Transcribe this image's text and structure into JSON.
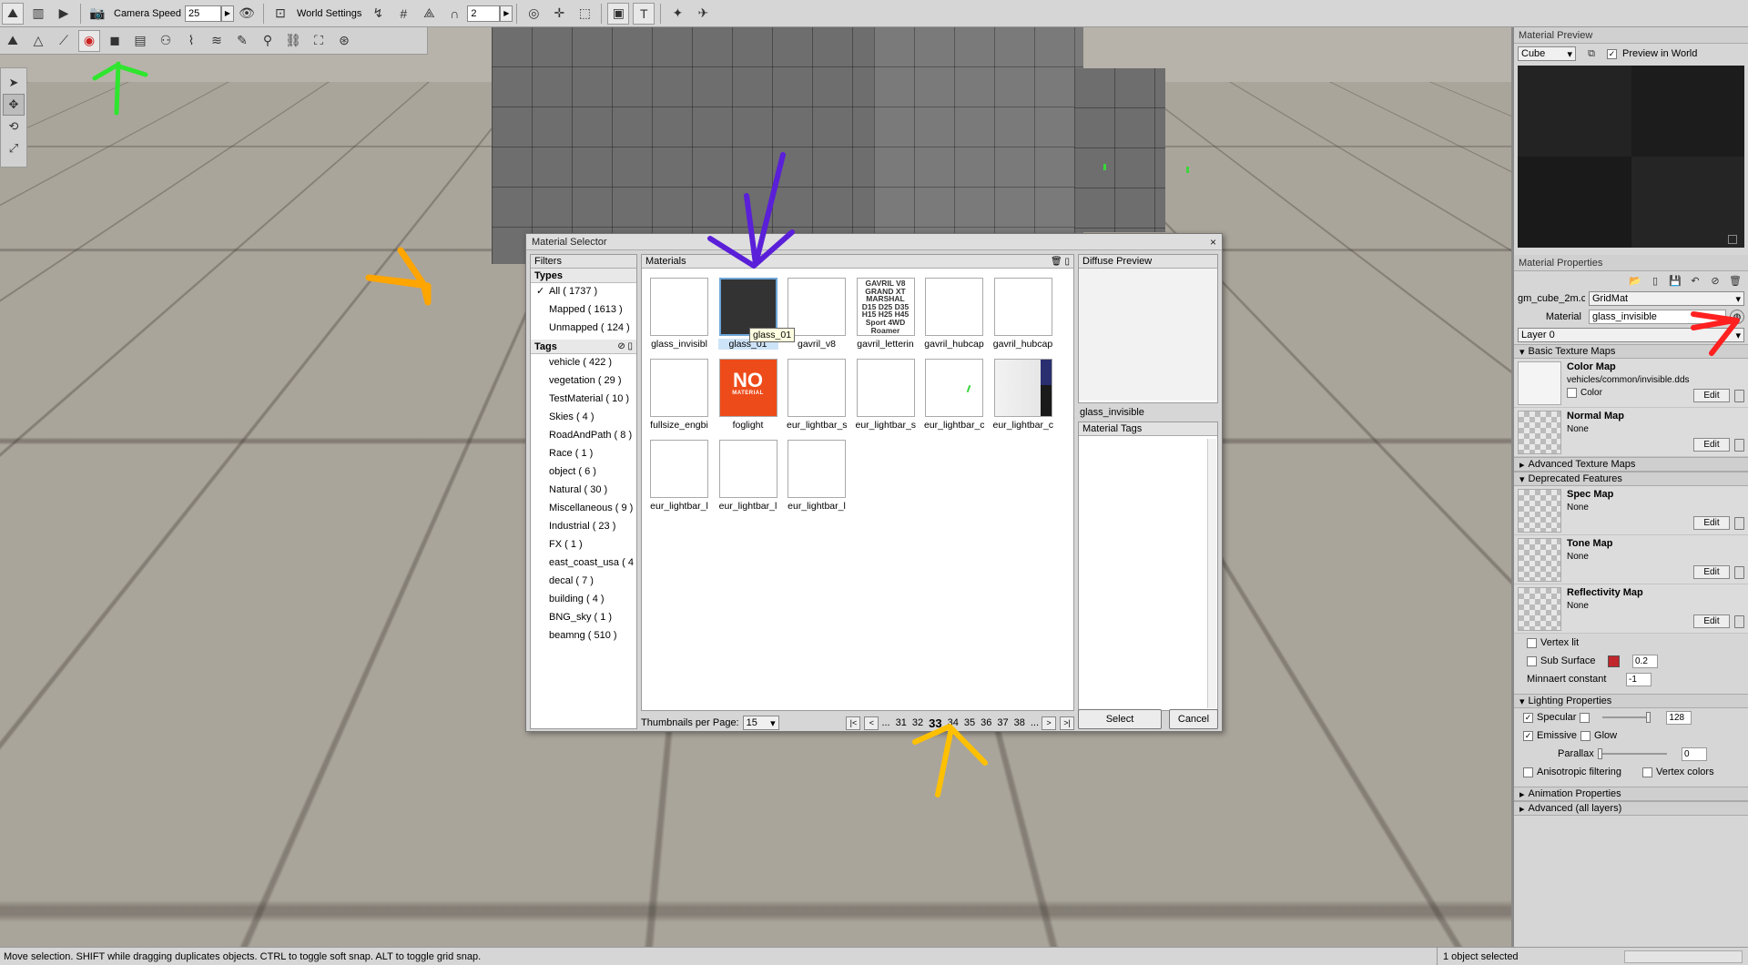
{
  "toolbar": {
    "camera_speed_label": "Camera Speed",
    "camera_speed_value": "25",
    "world_settings_label": "World Settings",
    "snap_value": "2"
  },
  "statusbar": {
    "message": "Move selection.  SHIFT while dragging duplicates objects.  CTRL to toggle soft snap.  ALT to toggle grid snap.",
    "selected": "1 object selected"
  },
  "material_preview": {
    "title": "Material Preview",
    "shape": "Cube",
    "preview_in_world": "Preview in World"
  },
  "material_properties": {
    "title": "Material Properties",
    "object_name": "gm_cube_2m.c",
    "object_material": "GridMat",
    "material_label": "Material",
    "material_value": "glass_invisible",
    "layer": "Layer 0",
    "basic_texture_maps": "Basic Texture Maps",
    "color_map": {
      "name": "Color Map",
      "path": "vehicles/common/invisible.dds",
      "color_label": "Color",
      "edit": "Edit"
    },
    "normal_map": {
      "name": "Normal Map",
      "value": "None",
      "edit": "Edit"
    },
    "advanced_texture_maps": "Advanced Texture Maps",
    "deprecated_features": "Deprecated Features",
    "spec_map": {
      "name": "Spec Map",
      "value": "None",
      "edit": "Edit"
    },
    "tone_map": {
      "name": "Tone Map",
      "value": "None",
      "edit": "Edit"
    },
    "reflectivity_map": {
      "name": "Reflectivity Map",
      "value": "None",
      "edit": "Edit"
    },
    "vertex_lit": "Vertex lit",
    "sub_surface": "Sub Surface",
    "sub_surface_value": "0.2",
    "sub_surface_color": "#c0262b",
    "minnaert_label": "Minnaert constant",
    "minnaert_value": "-1",
    "lighting_properties": "Lighting Properties",
    "specular": "Specular",
    "specular_value": "128",
    "emissive": "Emissive",
    "glow": "Glow",
    "parallax": "Parallax",
    "parallax_value": "0",
    "anisotropic": "Anisotropic filtering",
    "vertex_colors": "Vertex colors",
    "animation_properties": "Animation Properties",
    "advanced_all_layers": "Advanced (all layers)"
  },
  "dialog": {
    "title": "Material Selector",
    "filters_label": "Filters",
    "types_label": "Types",
    "types": [
      {
        "label": "All ( 1737 )",
        "checked": "✓"
      },
      {
        "label": "Mapped ( 1613 )",
        "checked": ""
      },
      {
        "label": "Unmapped ( 124 )",
        "checked": ""
      }
    ],
    "tags_label": "Tags",
    "tags": [
      "vehicle ( 422 )",
      "vegetation ( 29 )",
      "TestMaterial ( 10 )",
      "Skies ( 4 )",
      "RoadAndPath ( 8 )",
      "Race ( 1 )",
      "object ( 6 )",
      "Natural ( 30 )",
      "Miscellaneous ( 9 )",
      "Industrial ( 23 )",
      "FX ( 1 )",
      "east_coast_usa ( 4",
      "decal ( 7 )",
      "building ( 4 )",
      "BNG_sky ( 1 )",
      "beamng ( 510 )"
    ],
    "materials_label": "Materials",
    "materials": [
      "glass_invisibl",
      "glass_01",
      "gavril_v8",
      "gavril_letterin",
      "gavril_hubcap",
      "gavril_hubcap",
      "fullsize_engbi",
      "foglight",
      "eur_lightbar_s",
      "eur_lightbar_s",
      "eur_lightbar_c",
      "eur_lightbar_c",
      "eur_lightbar_l",
      "eur_lightbar_l",
      "eur_lightbar_l"
    ],
    "tooltip": "glass_01",
    "lettering_lines": [
      "GAVRIL V8",
      "GRAND XT",
      "MARSHAL",
      "D15 D25 D35",
      "H15 H25 H45",
      "Sport 4WD",
      "Roamer"
    ],
    "no_material_big": "NO",
    "no_material_small": "MATERIAL",
    "thumbs_per_page_label": "Thumbnails per Page:",
    "thumbs_per_page_value": "15",
    "pager": {
      "first": "|<",
      "prev": "<",
      "ellipsis_left": "...",
      "pages": [
        "31",
        "32",
        "33",
        "34",
        "35",
        "36",
        "37",
        "38"
      ],
      "current": "33",
      "ellipsis_right": "...",
      "next": ">",
      "last": ">|"
    },
    "diffuse_preview_label": "Diffuse Preview",
    "preview_name": "glass_invisible",
    "material_tags_label": "Material Tags",
    "select_button": "Select",
    "cancel_button": "Cancel"
  },
  "colors": {
    "annotation_green": "#2ee62e",
    "annotation_orange": "#ffa500",
    "annotation_purple": "#5a1fd8",
    "annotation_red": "#ff2020",
    "annotation_yellow": "#ffc000",
    "no_material_bg": "#ee4b1a",
    "truck_blue": "#2b6f86"
  }
}
